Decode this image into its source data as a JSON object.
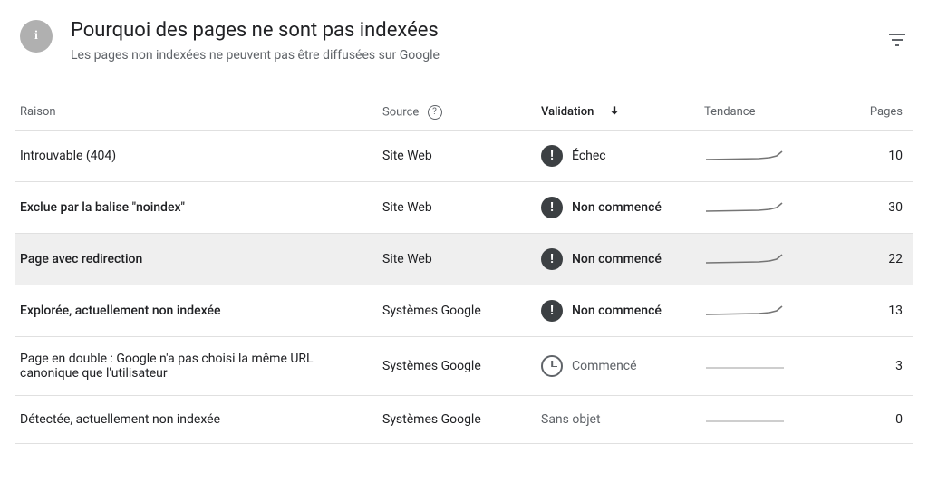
{
  "header": {
    "info_glyph": "i",
    "title": "Pourquoi des pages ne sont pas indexées",
    "subtitle": "Les pages non indexées ne peuvent pas être diffusées sur Google"
  },
  "columns": {
    "reason": "Raison",
    "source": "Source",
    "validation": "Validation",
    "trend": "Tendance",
    "pages": "Pages"
  },
  "validation_labels": {
    "fail": "Échec",
    "not_started": "Non commencé",
    "started": "Commencé",
    "na": "Sans objet"
  },
  "rows": [
    {
      "reason": "Introuvable (404)",
      "source": "Site Web",
      "v_icon": "excl",
      "v_key": "fail",
      "bold": false,
      "selected": false,
      "pages": "10",
      "trend": "up"
    },
    {
      "reason": "Exclue par la balise \"noindex\"",
      "source": "Site Web",
      "v_icon": "excl",
      "v_key": "not_started",
      "bold": true,
      "selected": false,
      "pages": "30",
      "trend": "up"
    },
    {
      "reason": "Page avec redirection",
      "source": "Site Web",
      "v_icon": "excl",
      "v_key": "not_started",
      "bold": true,
      "selected": true,
      "pages": "22",
      "trend": "up"
    },
    {
      "reason": "Explorée, actuellement non indexée",
      "source": "Systèmes Google",
      "v_icon": "excl",
      "v_key": "not_started",
      "bold": true,
      "selected": false,
      "pages": "13",
      "trend": "up"
    },
    {
      "reason": "Page en double : Google n'a pas choisi la même URL canonique que l'utilisateur",
      "source": "Systèmes Google",
      "v_icon": "clock",
      "v_key": "started",
      "bold": false,
      "selected": false,
      "pages": "3",
      "trend": "flat"
    },
    {
      "reason": "Détectée, actuellement non indexée",
      "source": "Systèmes Google",
      "v_icon": "none",
      "v_key": "na",
      "bold": false,
      "selected": false,
      "pages": "0",
      "trend": "flat"
    }
  ]
}
